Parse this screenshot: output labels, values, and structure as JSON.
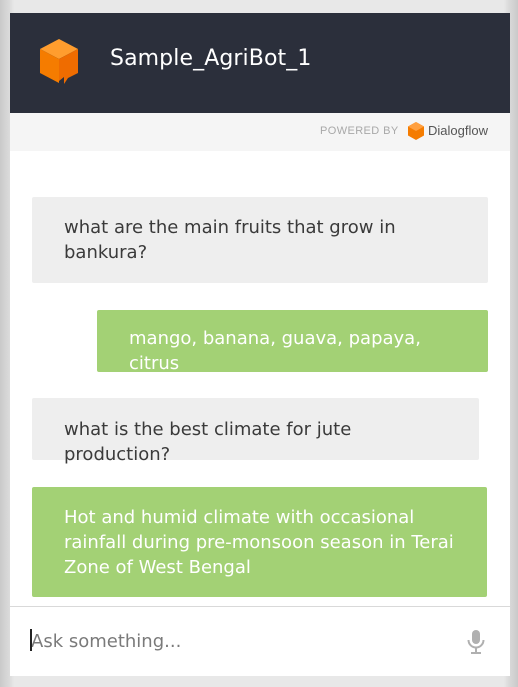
{
  "header": {
    "agent_name": "Sample_AgriBot_1",
    "icon": "agent-cube-icon",
    "background_color": "#2b2f3b"
  },
  "powered_by": {
    "label": "POWERED BY",
    "brand": "Dialogflow",
    "icon": "dialogflow-logo-icon",
    "brand_color": "#f57c00"
  },
  "messages": [
    {
      "role": "user",
      "text": "what are the main fruits that grow in bankura?"
    },
    {
      "role": "bot",
      "text": "mango, banana, guava, papaya, citrus"
    },
    {
      "role": "user",
      "text": "what is the best climate for jute production?"
    },
    {
      "role": "bot",
      "text": "Hot and humid climate with occasional rainfall during pre-monsoon season in Terai Zone of West Bengal"
    }
  ],
  "colors": {
    "user_bubble": "#eeeeee",
    "bot_bubble": "#a3d175"
  },
  "input": {
    "placeholder": "Ask something...",
    "value": "",
    "mic_icon": "microphone-icon"
  }
}
